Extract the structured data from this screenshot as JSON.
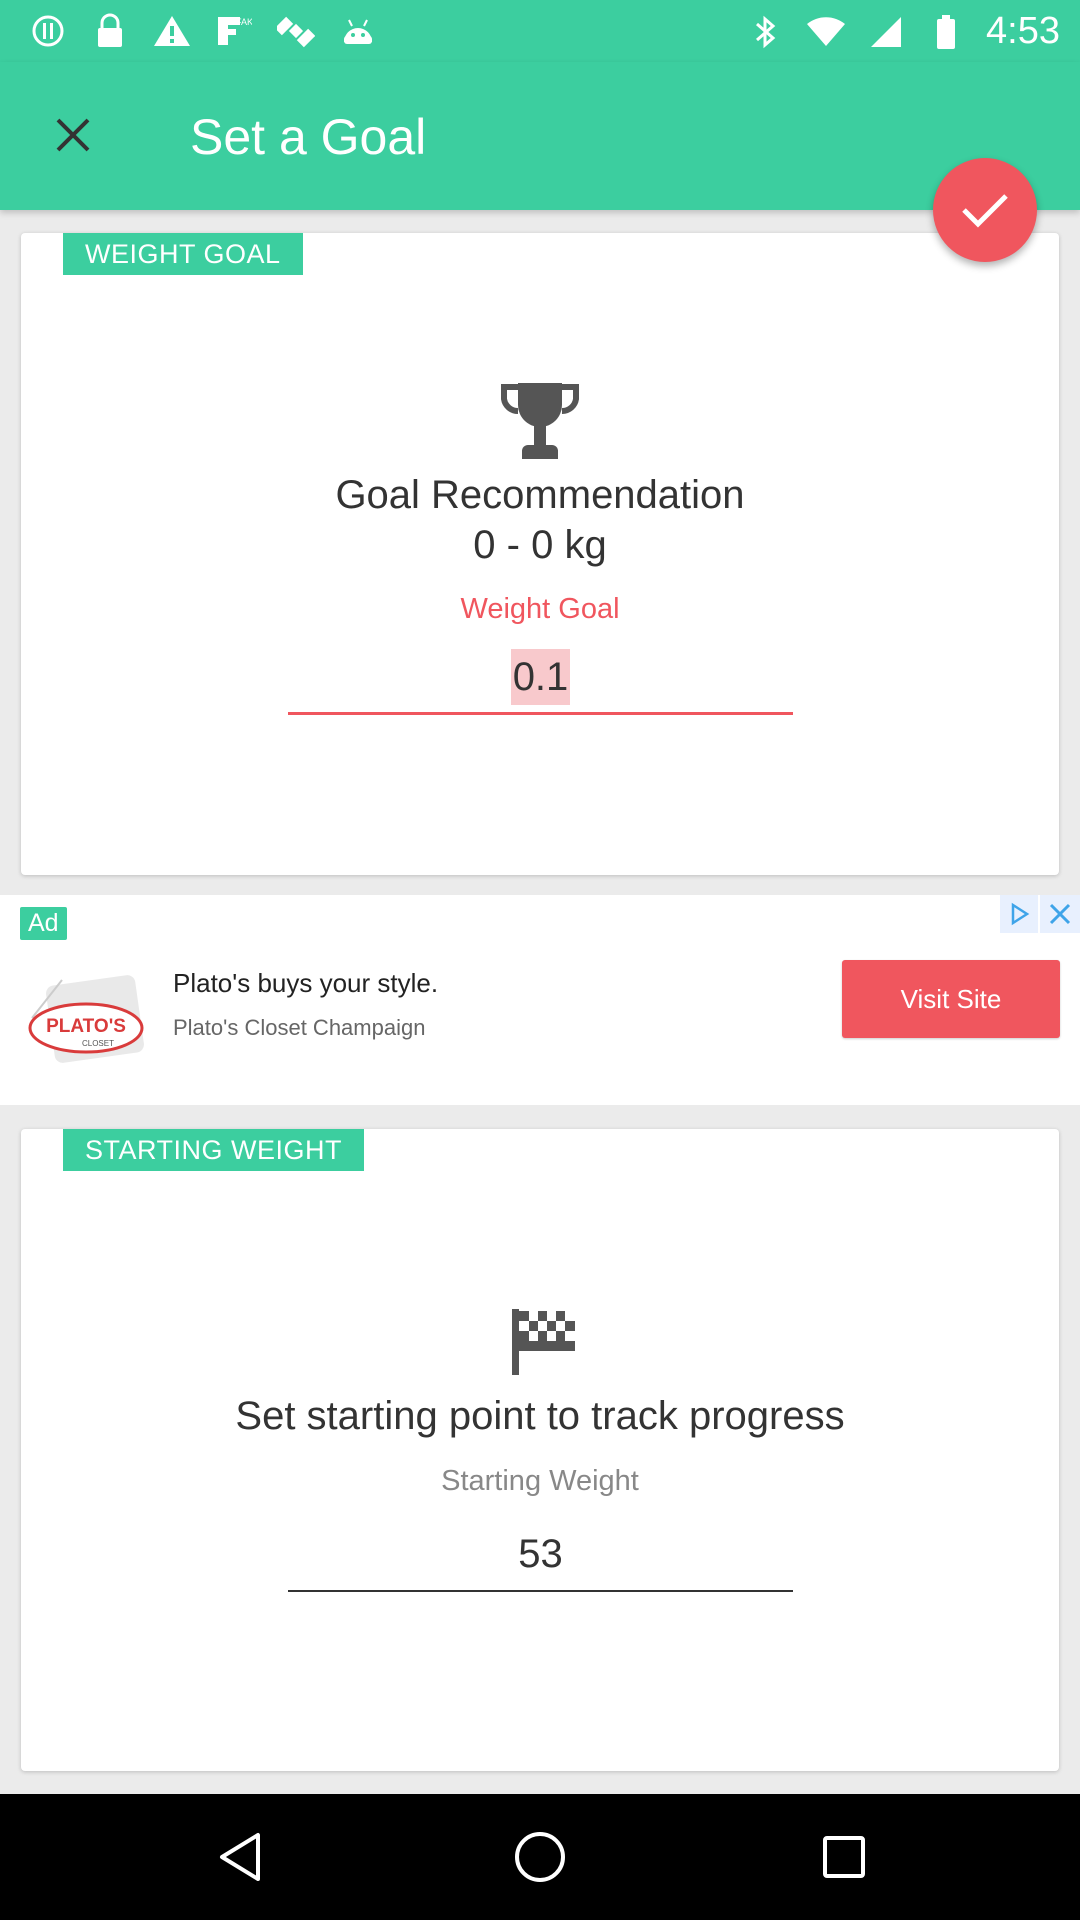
{
  "status_bar": {
    "time": "4:53",
    "icons_left": [
      "alert-circle-icon",
      "lock-icon",
      "warning-icon",
      "fake-gps-icon",
      "satellite-icon",
      "android-icon"
    ],
    "icons_right": [
      "bluetooth-icon",
      "wifi-icon",
      "signal-icon",
      "battery-icon"
    ]
  },
  "app_bar": {
    "title": "Set a Goal",
    "close_icon": "close-icon",
    "confirm_icon": "check-icon"
  },
  "weight_goal_card": {
    "tag": "WEIGHT GOAL",
    "icon": "trophy-icon",
    "recommendation_title": "Goal Recommendation",
    "recommendation_range": "0 - 0 kg",
    "field_label": "Weight Goal",
    "field_value": "0.1"
  },
  "ad": {
    "badge": "Ad",
    "headline": "Plato's buys your style.",
    "subtitle": "Plato's Closet Champaign",
    "button_label": "Visit Site",
    "logo_text": "PLATO'S",
    "logo_sub": "CLOSET"
  },
  "starting_weight_card": {
    "tag": "STARTING WEIGHT",
    "icon": "checkered-flag-icon",
    "heading": "Set starting point to track progress",
    "field_label": "Starting Weight",
    "field_value": "53"
  },
  "nav_bar": {
    "buttons": [
      "back-icon",
      "home-icon",
      "recents-icon"
    ]
  },
  "colors": {
    "primary": "#3cce9f",
    "accent": "#f0565e",
    "selection": "#f8c9cc"
  }
}
